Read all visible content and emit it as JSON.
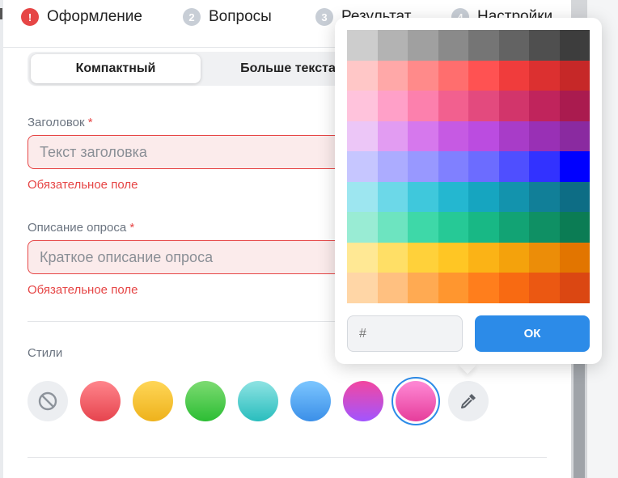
{
  "steps": [
    {
      "num": "!",
      "label": "Оформление",
      "state": "error"
    },
    {
      "num": "2",
      "label": "Вопросы"
    },
    {
      "num": "3",
      "label": "Результат"
    },
    {
      "num": "4",
      "label": "Настройки"
    }
  ],
  "layout_toggle": {
    "options": [
      "Компактный",
      "Больше текста"
    ],
    "selected": "Компактный"
  },
  "title_field": {
    "label": "Заголовок",
    "required_mark": "*",
    "placeholder": "Текст заголовка",
    "error": "Обязательное поле"
  },
  "description_field": {
    "label": "Описание опроса",
    "required_mark": "*",
    "placeholder": "Краткое описание опроса",
    "error": "Обязательное поле"
  },
  "styles": {
    "label": "Стили",
    "swatches": [
      {
        "name": "none",
        "icon": "no-style-icon"
      },
      {
        "name": "red",
        "from": "#ff858c",
        "to": "#e6444e"
      },
      {
        "name": "yellow",
        "from": "#ffd657",
        "to": "#eeb21c"
      },
      {
        "name": "green",
        "from": "#7ddb72",
        "to": "#2cbd34"
      },
      {
        "name": "teal",
        "from": "#8ee3e3",
        "to": "#29bdbd"
      },
      {
        "name": "blue",
        "from": "#7cc6ff",
        "to": "#3b8fe8"
      },
      {
        "name": "purple-pink",
        "from": "#f347a1",
        "to": "#a155ff"
      },
      {
        "name": "pink",
        "from": "#ff8ad6",
        "to": "#e63d9b",
        "selected": true
      },
      {
        "name": "custom",
        "icon": "eyedropper-icon"
      }
    ]
  },
  "color_picker": {
    "hex_placeholder": "#",
    "ok_label": "ОК",
    "palette": [
      [
        "#cdcdcd",
        "#b3b3b3",
        "#a0a0a0",
        "#8a8a8a",
        "#757575",
        "#636363",
        "#4f4f4f",
        "#3d3d3d"
      ],
      [
        "#ffc7c7",
        "#ffa8a8",
        "#ff8a8a",
        "#ff6e6e",
        "#ff5252",
        "#f03c3c",
        "#dc3030",
        "#c62828"
      ],
      [
        "#ffc3dc",
        "#ffa0c8",
        "#fc80ad",
        "#f2608f",
        "#e34a7e",
        "#d2356b",
        "#c0245c",
        "#aa1b4f"
      ],
      [
        "#ecc6f7",
        "#e29cf2",
        "#d678ed",
        "#c65ae3",
        "#bb4ce0",
        "#a83cc8",
        "#9930b5",
        "#8a2aa0"
      ],
      [
        "#c6c6ff",
        "#acacff",
        "#9898ff",
        "#8080ff",
        "#6c6cff",
        "#4f4fff",
        "#3232ff",
        "#0000ff"
      ],
      [
        "#9de6f0",
        "#6cd8e8",
        "#3fc8dc",
        "#24b7d0",
        "#16a5c0",
        "#1393ad",
        "#117f98",
        "#0d6d85"
      ],
      [
        "#99ecd4",
        "#6de4c0",
        "#3ed8a8",
        "#26c996",
        "#18b885",
        "#12a374",
        "#0f9064",
        "#0b7c54"
      ],
      [
        "#ffe894",
        "#ffdf66",
        "#ffd13a",
        "#ffc624",
        "#fbb316",
        "#f4a20c",
        "#ec8d08",
        "#e27500"
      ],
      [
        "#ffd6a6",
        "#ffc080",
        "#ffaa52",
        "#ff962f",
        "#ff7e1c",
        "#f86a12",
        "#eb5812",
        "#db4712"
      ]
    ]
  }
}
